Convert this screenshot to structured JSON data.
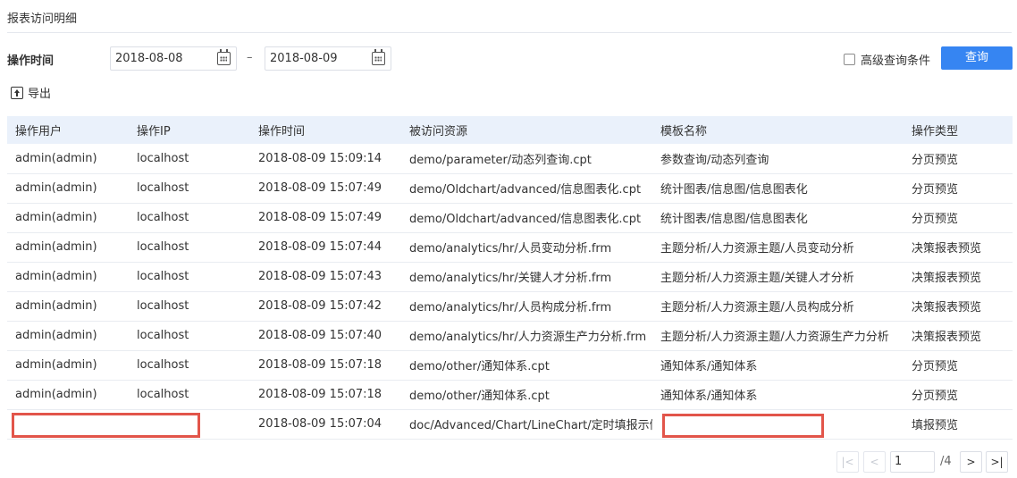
{
  "page": {
    "title": "报表访问明细"
  },
  "filter": {
    "label": "操作时间",
    "start_date": "2018-08-08",
    "end_date": "2018-08-09",
    "separator": "–",
    "advanced_label": "高级查询条件",
    "query_label": "查询"
  },
  "toolbar": {
    "export_label": "导出"
  },
  "table": {
    "columns": [
      "操作用户",
      "操作IP",
      "操作时间",
      "被访问资源",
      "模板名称",
      "操作类型"
    ],
    "rows": [
      [
        "admin(admin)",
        "localhost",
        "2018-08-09 15:09:14",
        "demo/parameter/动态列查询.cpt",
        "参数查询/动态列查询",
        "分页预览"
      ],
      [
        "admin(admin)",
        "localhost",
        "2018-08-09 15:07:49",
        "demo/Oldchart/advanced/信息图表化.cpt",
        "统计图表/信息图/信息图表化",
        "分页预览"
      ],
      [
        "admin(admin)",
        "localhost",
        "2018-08-09 15:07:49",
        "demo/Oldchart/advanced/信息图表化.cpt",
        "统计图表/信息图/信息图表化",
        "分页预览"
      ],
      [
        "admin(admin)",
        "localhost",
        "2018-08-09 15:07:44",
        "demo/analytics/hr/人员变动分析.frm",
        "主题分析/人力资源主题/人员变动分析",
        "决策报表预览"
      ],
      [
        "admin(admin)",
        "localhost",
        "2018-08-09 15:07:43",
        "demo/analytics/hr/关键人才分析.frm",
        "主题分析/人力资源主题/关键人才分析",
        "决策报表预览"
      ],
      [
        "admin(admin)",
        "localhost",
        "2018-08-09 15:07:42",
        "demo/analytics/hr/人员构成分析.frm",
        "主题分析/人力资源主题/人员构成分析",
        "决策报表预览"
      ],
      [
        "admin(admin)",
        "localhost",
        "2018-08-09 15:07:40",
        "demo/analytics/hr/人力资源生产力分析.frm",
        "主题分析/人力资源主题/人力资源生产力分析",
        "决策报表预览"
      ],
      [
        "admin(admin)",
        "localhost",
        "2018-08-09 15:07:18",
        "demo/other/通知体系.cpt",
        "通知体系/通知体系",
        "分页预览"
      ],
      [
        "admin(admin)",
        "localhost",
        "2018-08-09 15:07:18",
        "demo/other/通知体系.cpt",
        "通知体系/通知体系",
        "分页预览"
      ],
      [
        "",
        "",
        "2018-08-09 15:07:04",
        "doc/Advanced/Chart/LineChart/定时填报示例...",
        "",
        "填报预览"
      ]
    ]
  },
  "pagination": {
    "current_page": "1",
    "total": "/4"
  },
  "colors": {
    "accent": "#3685f2",
    "header_bg": "#eaf1fb",
    "redaction": "#e2554a"
  },
  "icons": {
    "calendar": "calendar-icon",
    "export": "export-icon",
    "checkbox": "checkbox-icon"
  }
}
